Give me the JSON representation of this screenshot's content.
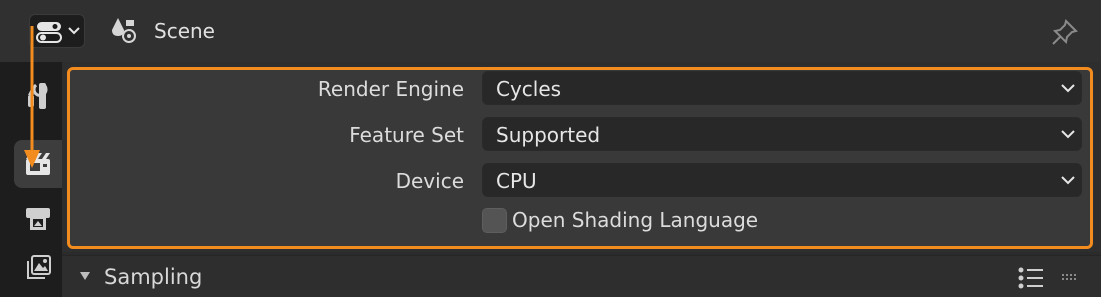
{
  "header": {
    "editor_type_icon": "properties-editor-icon",
    "context_icon": "scene-icon",
    "context_label": "Scene",
    "pin_icon": "pin-icon"
  },
  "tabs": [
    {
      "icon": "tool-icon",
      "active": false
    },
    {
      "icon": "render-icon",
      "active": true
    },
    {
      "icon": "output-icon",
      "active": false
    },
    {
      "icon": "view-layer-icon",
      "active": false
    }
  ],
  "render": {
    "engine_label": "Render Engine",
    "engine_value": "Cycles",
    "feature_set_label": "Feature Set",
    "feature_set_value": "Supported",
    "device_label": "Device",
    "device_value": "CPU",
    "osl_label": "Open Shading Language",
    "osl_checked": false
  },
  "sampling": {
    "title": "Sampling",
    "expanded": false
  },
  "colors": {
    "highlight": "#f28c1e",
    "panel": "#393939",
    "field": "#282828"
  }
}
